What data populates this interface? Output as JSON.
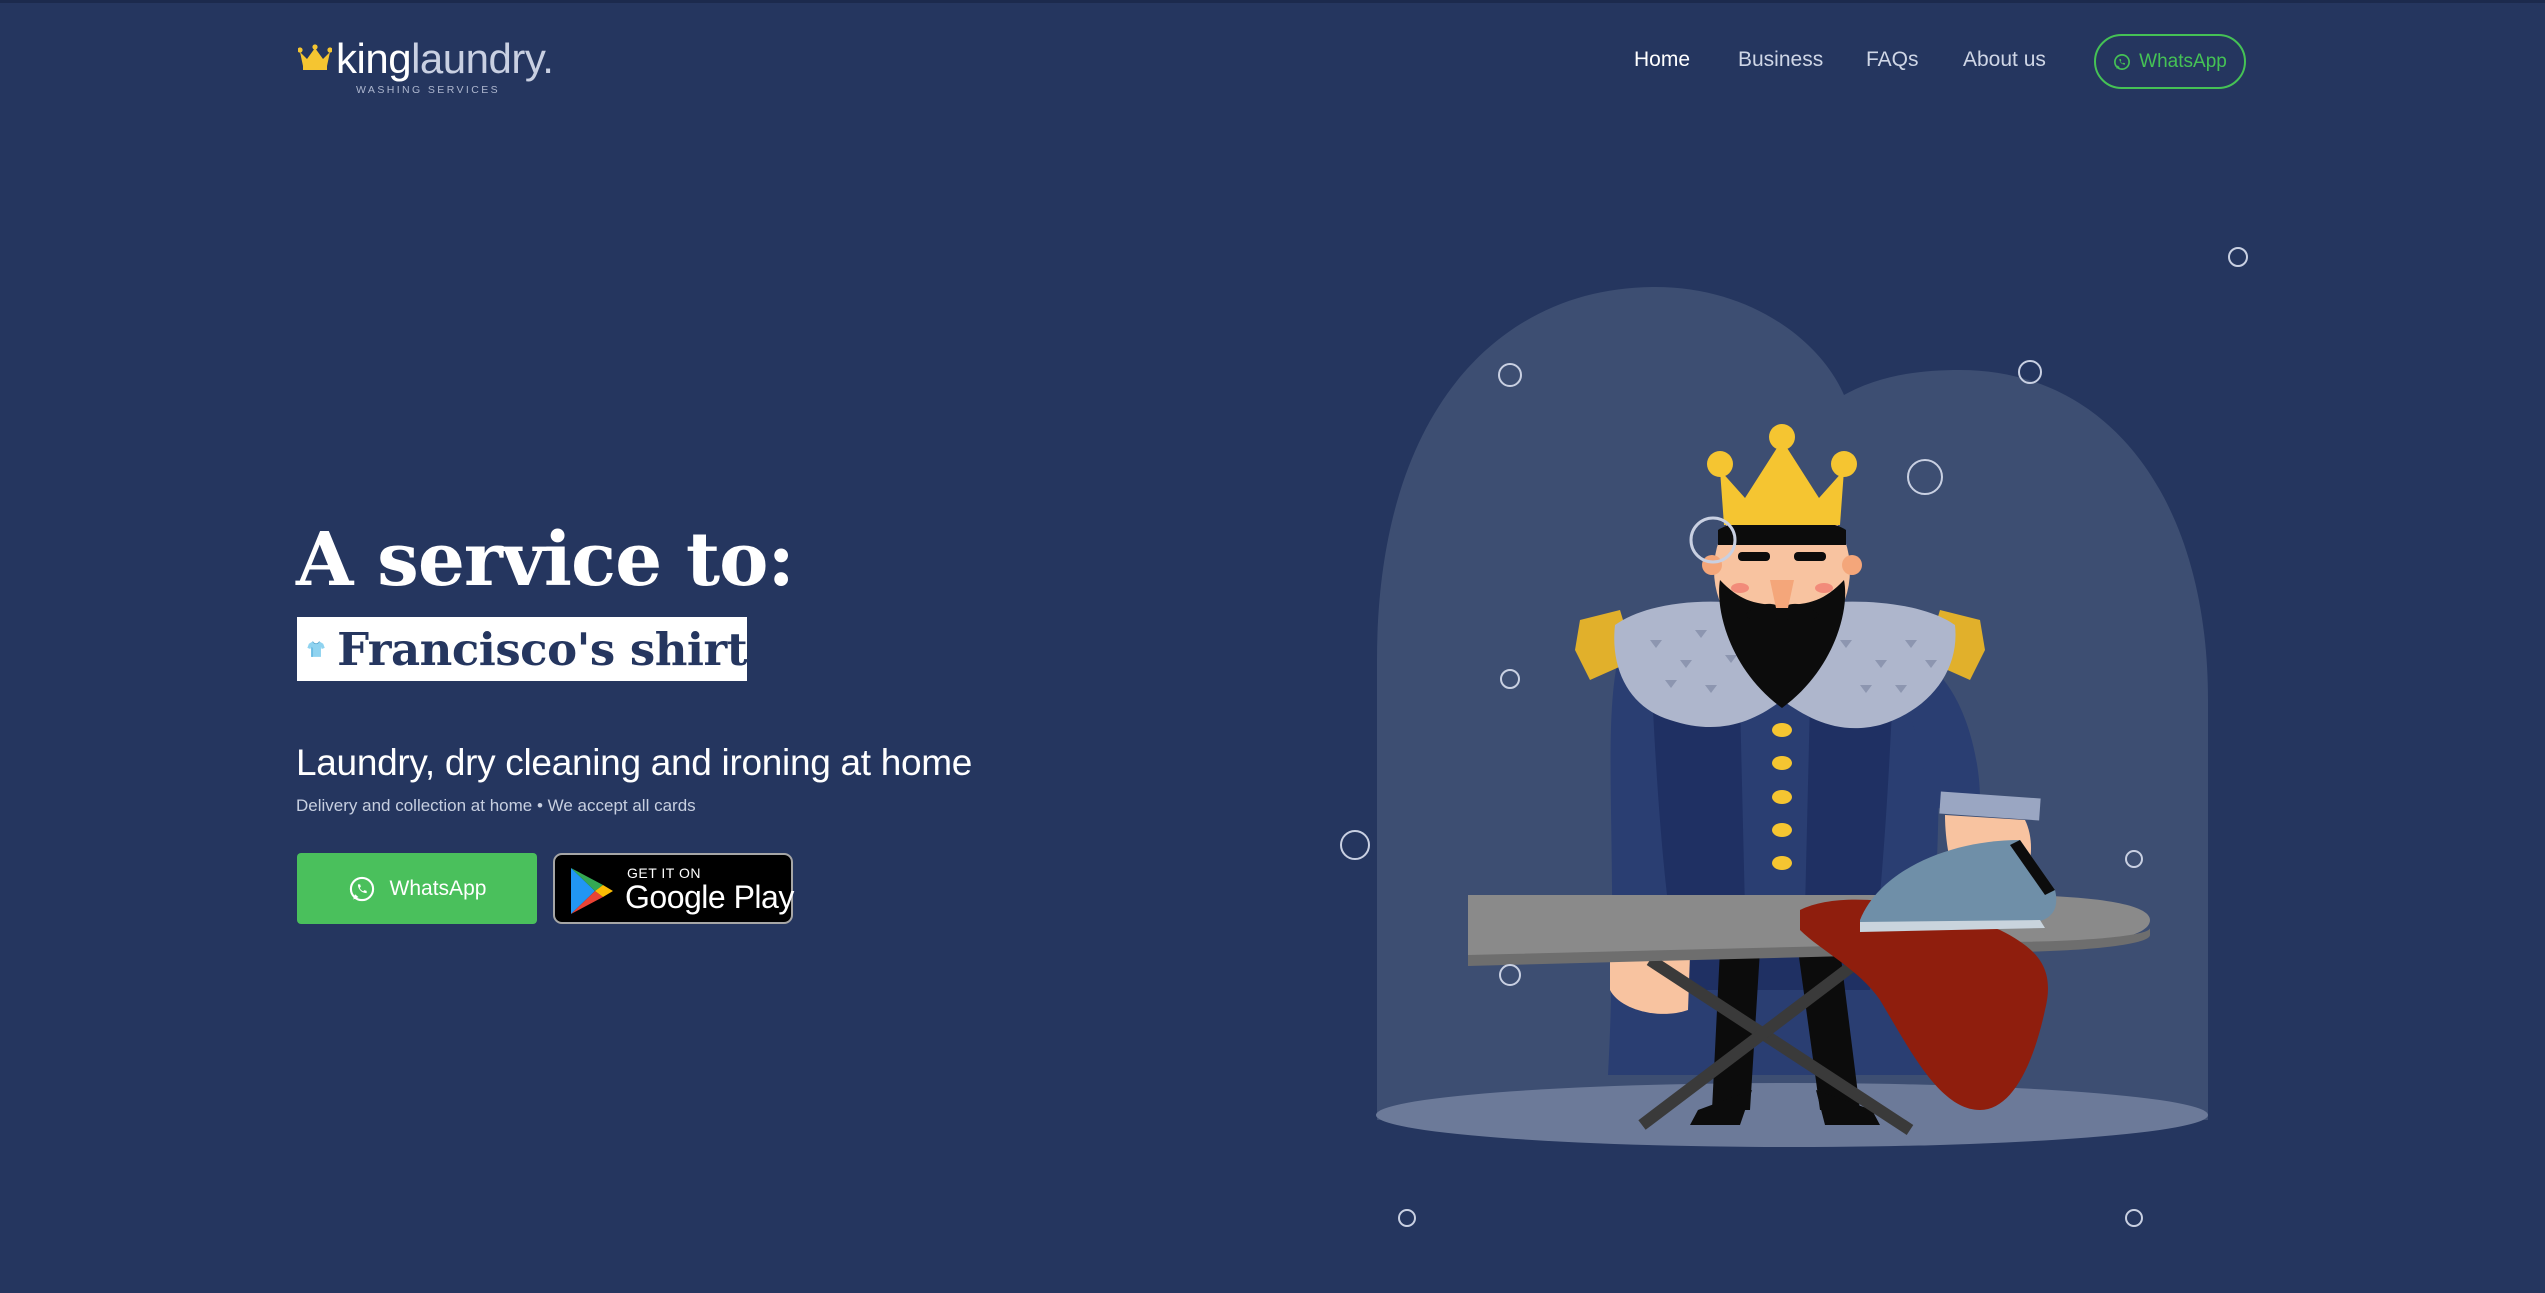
{
  "header": {
    "logo": {
      "brand_bold": "king",
      "brand_light": "laundry",
      "brand_dot": ".",
      "tagline": "WASHING SERVICES",
      "icon": "crown-icon"
    },
    "nav": [
      {
        "label": "Home",
        "active": true
      },
      {
        "label": "Business",
        "active": false
      },
      {
        "label": "FAQs",
        "active": false
      },
      {
        "label": "About us",
        "active": false
      }
    ],
    "cta": {
      "label": "WhatsApp",
      "icon": "whatsapp-icon"
    }
  },
  "hero": {
    "title": "A service to:",
    "rotating_item": {
      "icon": "t-shirt-icon",
      "text": "Francisco's shirt"
    },
    "subtitle": "Laundry, dry cleaning and ironing at home",
    "note": "Delivery and collection at home • We accept all cards",
    "whatsapp_button": {
      "label": "WhatsApp",
      "icon": "whatsapp-icon"
    },
    "google_play": {
      "line1": "GET IT ON",
      "line2": "Google Play",
      "icon": "google-play-icon"
    }
  },
  "illustration": {
    "name": "king-ironing-illustration"
  },
  "colors": {
    "background": "#25365f",
    "whatsapp_green": "#4ac05c",
    "crown_gold": "#f5c531",
    "cloth_red": "#8f1e0d"
  }
}
